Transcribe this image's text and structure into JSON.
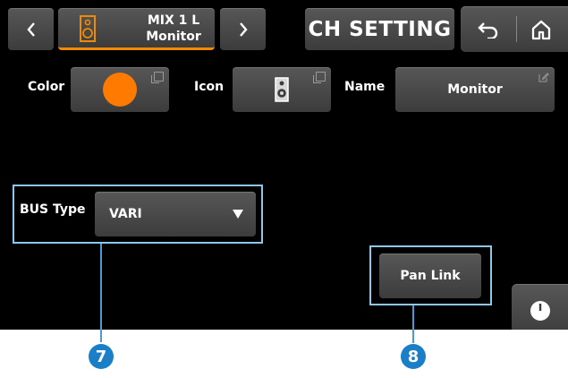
{
  "header": {
    "channel_line1": "MIX 1 L",
    "channel_line2": "Monitor",
    "title": "CH SETTING",
    "accent_color": "#f08a00"
  },
  "settings": {
    "color_label": "Color",
    "color_value": "#ff7a00",
    "icon_label": "Icon",
    "icon_value": "speaker-icon",
    "name_label": "Name",
    "name_value": "Monitor"
  },
  "bus": {
    "label": "BUS Type",
    "value": "VARI"
  },
  "pan_link": {
    "label": "Pan Link"
  },
  "callouts": {
    "bus_number": "7",
    "pan_number": "8"
  }
}
